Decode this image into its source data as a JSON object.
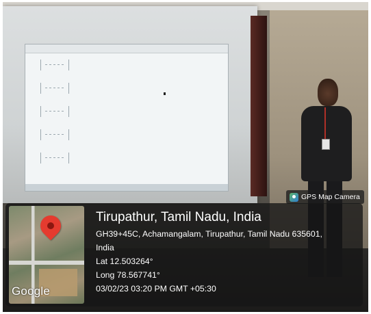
{
  "overlay": {
    "camera_tag": {
      "icon": "gps-map-camera-icon",
      "label": "GPS Map Camera"
    },
    "map": {
      "icon": "location-pin-icon",
      "logo": "Google"
    },
    "location": {
      "title": "Tirupathur, Tamil Nadu, India",
      "address_line1": "GH39+45C, Achamangalam, Tirupathur, Tamil Nadu 635601,",
      "address_line2": "India",
      "latitude": "Lat 12.503264°",
      "longitude": "Long 78.567741°",
      "timestamp": "03/02/23 03:20 PM GMT +05:30"
    },
    "colors": {
      "panel": "#161616",
      "pin": "#e53b2f",
      "text": "#ffffff"
    }
  }
}
